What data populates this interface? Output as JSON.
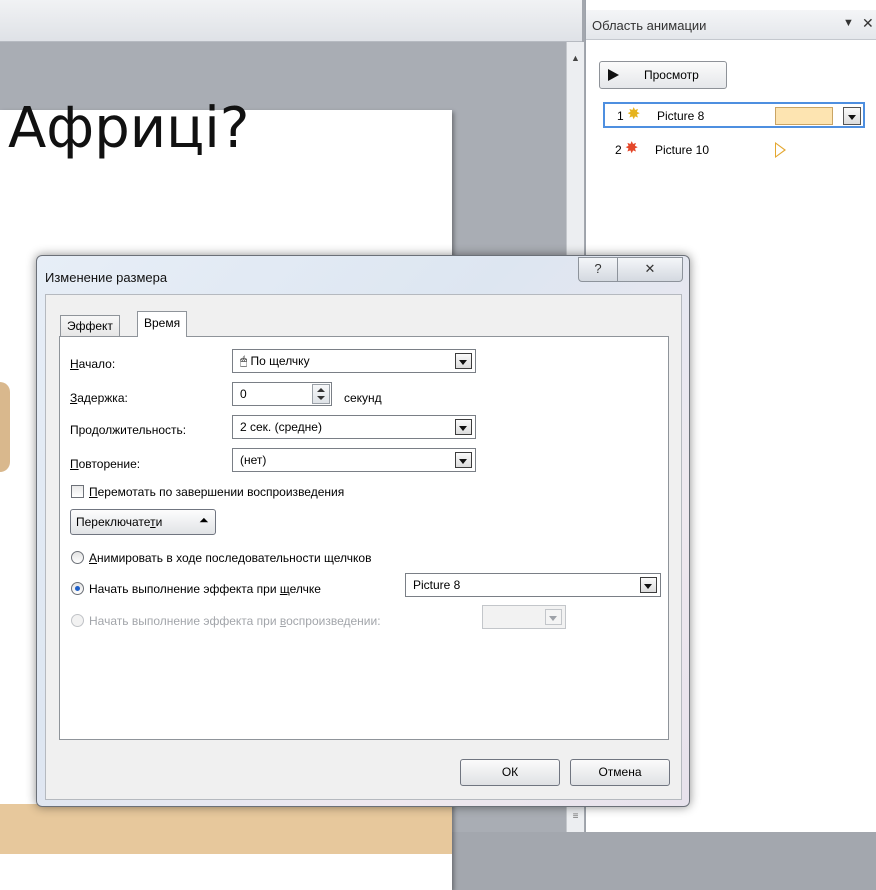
{
  "slide": {
    "title_fragment": "Африці?"
  },
  "animation_pane": {
    "title": "Область анимации",
    "menu_icon": "chevron-down-icon",
    "close_icon": "close-icon",
    "preview_label": "Просмотр",
    "items": [
      {
        "number": "1",
        "icon": "star-burst-icon",
        "name": "Picture 8",
        "selected": true
      },
      {
        "number": "2",
        "icon": "star-burst-icon",
        "name": "Picture 10",
        "selected": false
      }
    ]
  },
  "dialog": {
    "title": "Изменение размера",
    "help_glyph": "?",
    "close_glyph": "✕",
    "tabs": [
      {
        "label": "Эффект",
        "active": false
      },
      {
        "label": "Время",
        "active": true
      }
    ],
    "start": {
      "label": "Начало:",
      "value": "По щелчку",
      "icon": "mouse-click-icon"
    },
    "delay": {
      "label": "Задержка:",
      "value": "0",
      "unit": "секунд"
    },
    "duration": {
      "label": "Продолжительность:",
      "value": "2 сек. (средне)"
    },
    "repeat": {
      "label": "Повторение:",
      "value": "(нет)"
    },
    "rewind": {
      "label": "Перемотать по завершении воспроизведения",
      "checked": false
    },
    "triggers": {
      "label": "Переключатели",
      "icon": "collapse-arrows-icon"
    },
    "trigger_options": {
      "animate_sequence": {
        "label": "Анимировать в ходе последовательности щелчков",
        "selected": false
      },
      "start_on_click": {
        "label": "Начать выполнение эффекта при щелчке",
        "selected": true,
        "value": "Picture 8"
      },
      "start_on_play": {
        "label": "Начать выполнение эффекта при воспроизведении:",
        "selected": false,
        "disabled": true,
        "value": ""
      }
    },
    "ok_label": "ОК",
    "cancel_label": "Отмена"
  }
}
